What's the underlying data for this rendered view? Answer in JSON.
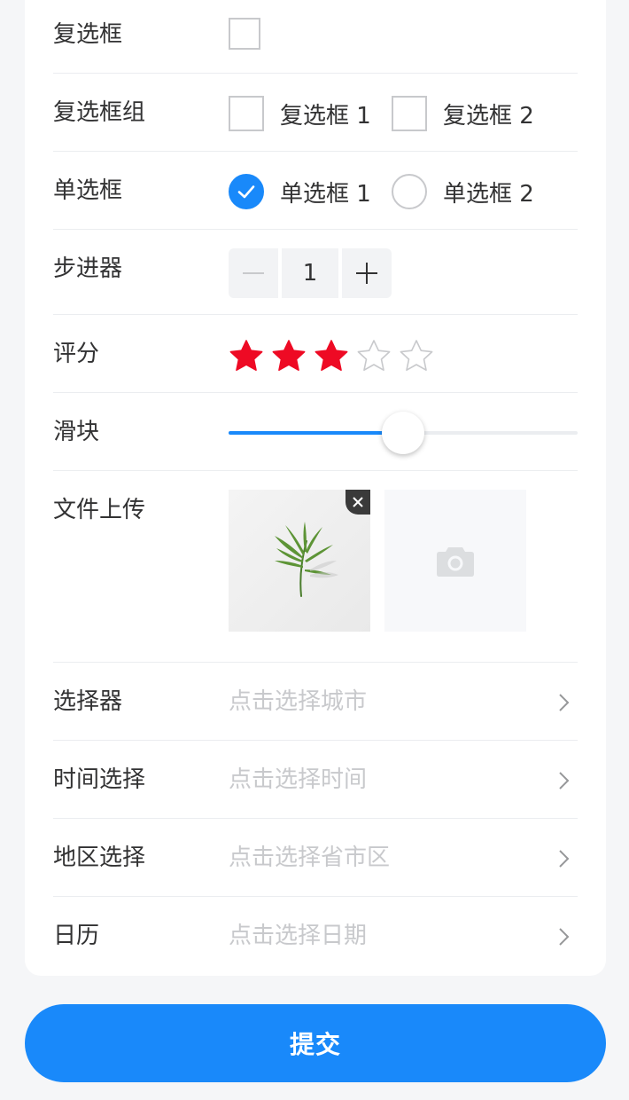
{
  "form": {
    "checkbox": {
      "label": "复选框",
      "checked": false
    },
    "checkbox_group": {
      "label": "复选框组",
      "options": [
        {
          "text": "复选框 1",
          "checked": false
        },
        {
          "text": "复选框 2",
          "checked": false
        }
      ]
    },
    "radio": {
      "label": "单选框",
      "options": [
        {
          "text": "单选框 1",
          "checked": true
        },
        {
          "text": "单选框 2",
          "checked": false
        }
      ]
    },
    "stepper": {
      "label": "步进器",
      "value": "1"
    },
    "rate": {
      "label": "评分",
      "value": 3,
      "max": 5
    },
    "slider": {
      "label": "滑块",
      "value_fraction": 0.5
    },
    "uploader": {
      "label": "文件上传"
    },
    "picker": {
      "label": "选择器",
      "placeholder": "点击选择城市"
    },
    "datetime": {
      "label": "时间选择",
      "placeholder": "点击选择时间"
    },
    "area": {
      "label": "地区选择",
      "placeholder": "点击选择省市区"
    },
    "calendar": {
      "label": "日历",
      "placeholder": "点击选择日期"
    }
  },
  "submit_label": "提交",
  "colors": {
    "primary": "#1989fa",
    "star_active": "#ee0a24",
    "placeholder": "#c8c9cc",
    "border": "#ebedf0"
  },
  "icons": {
    "checked": "check-icon",
    "minus": "minus-icon",
    "plus": "plus-icon",
    "star": "star-icon",
    "delete": "close-icon",
    "upload": "camera-icon",
    "arrow": "chevron-right-icon"
  }
}
